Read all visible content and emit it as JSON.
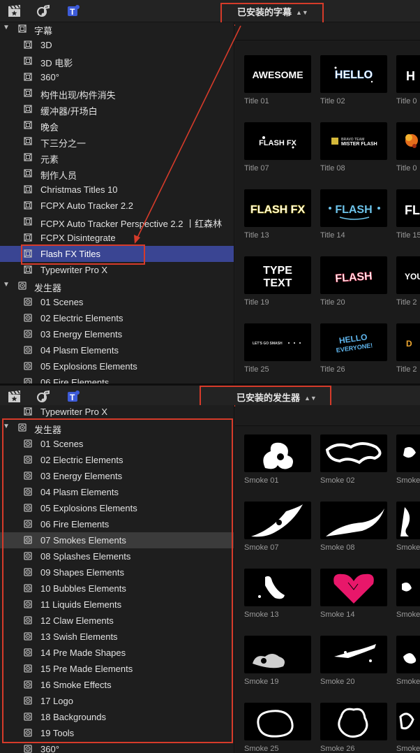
{
  "top": {
    "dropdown": "已安装的字幕",
    "sidebar": [
      {
        "label": "字幕",
        "kind": "cat"
      },
      {
        "label": "3D"
      },
      {
        "label": "3D 电影"
      },
      {
        "label": "360°"
      },
      {
        "label": "构件出现/构件消失"
      },
      {
        "label": "缓冲器/开场白"
      },
      {
        "label": "晚会"
      },
      {
        "label": "下三分之一"
      },
      {
        "label": "元素"
      },
      {
        "label": "制作人员"
      },
      {
        "label": "Christmas Titles 10"
      },
      {
        "label": "FCPX Auto Tracker 2.2"
      },
      {
        "label": "FCPX Auto Tracker Perspective 2.2 丨红森林"
      },
      {
        "label": "FCPX Disintegrate"
      },
      {
        "label": "Flash FX Titles",
        "selected": true
      },
      {
        "label": "Typewriter Pro X"
      },
      {
        "label": "发生器",
        "kind": "cat"
      },
      {
        "label": "01 Scenes"
      },
      {
        "label": "02 Electric Elements"
      },
      {
        "label": "03 Energy Elements"
      },
      {
        "label": "04 Plasm Elements"
      },
      {
        "label": "05 Explosions Elements"
      },
      {
        "label": "06 Fire Elements"
      }
    ],
    "thumbs": [
      {
        "label": "Title 01",
        "art": "AWESOME"
      },
      {
        "label": "Title 02",
        "art": "HELLO"
      },
      {
        "label": "Title 0",
        "art": "H"
      },
      {
        "label": "Title 07",
        "art": "FLASH FX"
      },
      {
        "label": "Title 08",
        "art": "MISTER FLASH"
      },
      {
        "label": "Title 0",
        "art": ""
      },
      {
        "label": "Title 13",
        "art": "FLASH FX"
      },
      {
        "label": "Title 14",
        "art": "FLASH"
      },
      {
        "label": "Title 15",
        "art": "FL"
      },
      {
        "label": "Title 19",
        "art": "TYPE TEXT"
      },
      {
        "label": "Title 20",
        "art": "FLASH"
      },
      {
        "label": "Title 2",
        "art": "YOU"
      },
      {
        "label": "Title 25",
        "art": "LET'S GO SMASH"
      },
      {
        "label": "Title 26",
        "art": "HELLO EVERYONE!"
      },
      {
        "label": "Title 2",
        "art": "D"
      }
    ]
  },
  "bottom": {
    "dropdown": "已安装的发生器",
    "sidebar": [
      {
        "label": "Typewriter Pro X"
      },
      {
        "label": "发生器",
        "kind": "cat"
      },
      {
        "label": "01 Scenes"
      },
      {
        "label": "02 Electric Elements"
      },
      {
        "label": "03 Energy Elements"
      },
      {
        "label": "04 Plasm Elements"
      },
      {
        "label": "05 Explosions Elements"
      },
      {
        "label": "06 Fire Elements"
      },
      {
        "label": "07 Smokes Elements",
        "hover": true
      },
      {
        "label": "08 Splashes Elements"
      },
      {
        "label": "09 Shapes Elements"
      },
      {
        "label": "10 Bubbles Elements"
      },
      {
        "label": "11 Liquids Elements"
      },
      {
        "label": "12 Claw Elements"
      },
      {
        "label": "13 Swish Elements"
      },
      {
        "label": "14 Pre Made Shapes"
      },
      {
        "label": "15 Pre Made Elements"
      },
      {
        "label": "16 Smoke Effects"
      },
      {
        "label": "17 Logo"
      },
      {
        "label": "18 Backgrounds"
      },
      {
        "label": "19 Tools"
      },
      {
        "label": "360°"
      }
    ],
    "thumbs": [
      {
        "label": "Smoke 01"
      },
      {
        "label": "Smoke 02"
      },
      {
        "label": "Smoke"
      },
      {
        "label": "Smoke 07"
      },
      {
        "label": "Smoke 08"
      },
      {
        "label": "Smoke"
      },
      {
        "label": "Smoke 13"
      },
      {
        "label": "Smoke 14"
      },
      {
        "label": "Smoke"
      },
      {
        "label": "Smoke 19"
      },
      {
        "label": "Smoke 20"
      },
      {
        "label": "Smoke"
      },
      {
        "label": "Smoke 25"
      },
      {
        "label": "Smoke 26"
      },
      {
        "label": "Smoke"
      }
    ]
  },
  "colors": {
    "selection": "#3a4593",
    "annotation": "#d63b2a",
    "heart": "#e8176a"
  }
}
